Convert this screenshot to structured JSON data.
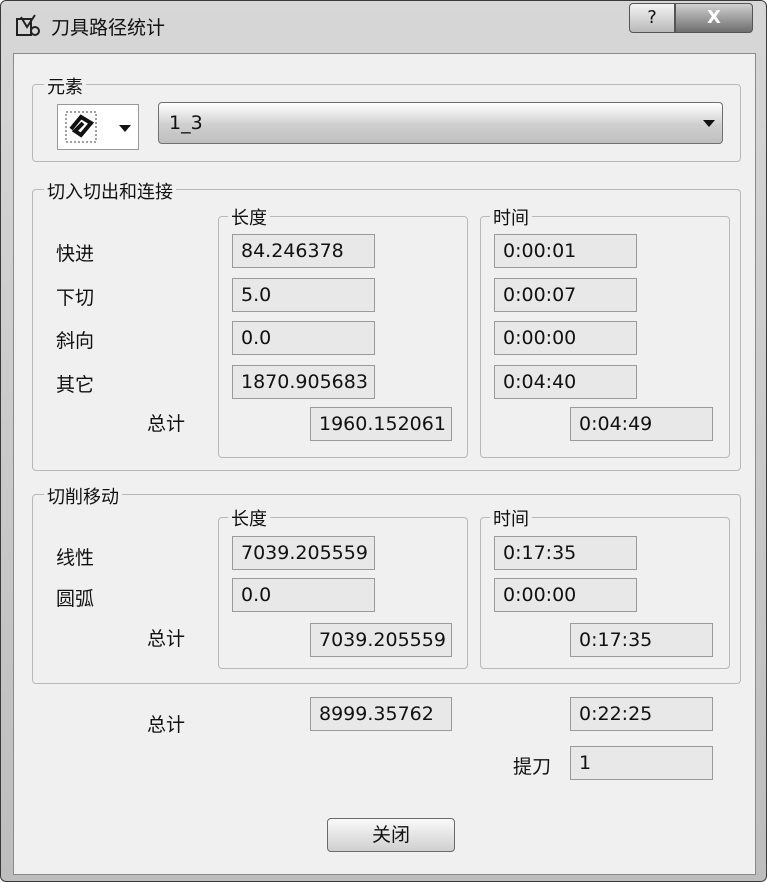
{
  "window": {
    "title": "刀具路径统计",
    "help_label": "?",
    "close_label": "X"
  },
  "element": {
    "group_label": "元素",
    "selected": "1_3",
    "icon": "toolpath-element-icon"
  },
  "entry_exit": {
    "group_label": "切入切出和连接",
    "length_header": "长度",
    "time_header": "时间",
    "rows": [
      {
        "label": "快进",
        "length": "84.246378",
        "time": "0:00:01"
      },
      {
        "label": "下切",
        "length": "5.0",
        "time": "0:00:07"
      },
      {
        "label": "斜向",
        "length": "0.0",
        "time": "0:00:00"
      },
      {
        "label": "其它",
        "length": "1870.905683",
        "time": "0:04:40"
      }
    ],
    "total_label": "总计",
    "total_length": "1960.152061",
    "total_time": "0:04:49"
  },
  "cutting": {
    "group_label": "切削移动",
    "length_header": "长度",
    "time_header": "时间",
    "rows": [
      {
        "label": "线性",
        "length": "7039.205559",
        "time": "0:17:35"
      },
      {
        "label": "圆弧",
        "length": "0.0",
        "time": "0:00:00"
      }
    ],
    "total_label": "总计",
    "total_length": "7039.205559",
    "total_time": "0:17:35"
  },
  "summary": {
    "total_label": "总计",
    "total_length": "8999.35762",
    "total_time": "0:22:25",
    "retract_label": "提刀",
    "retract_value": "1"
  },
  "footer": {
    "close_button": "关闭"
  }
}
